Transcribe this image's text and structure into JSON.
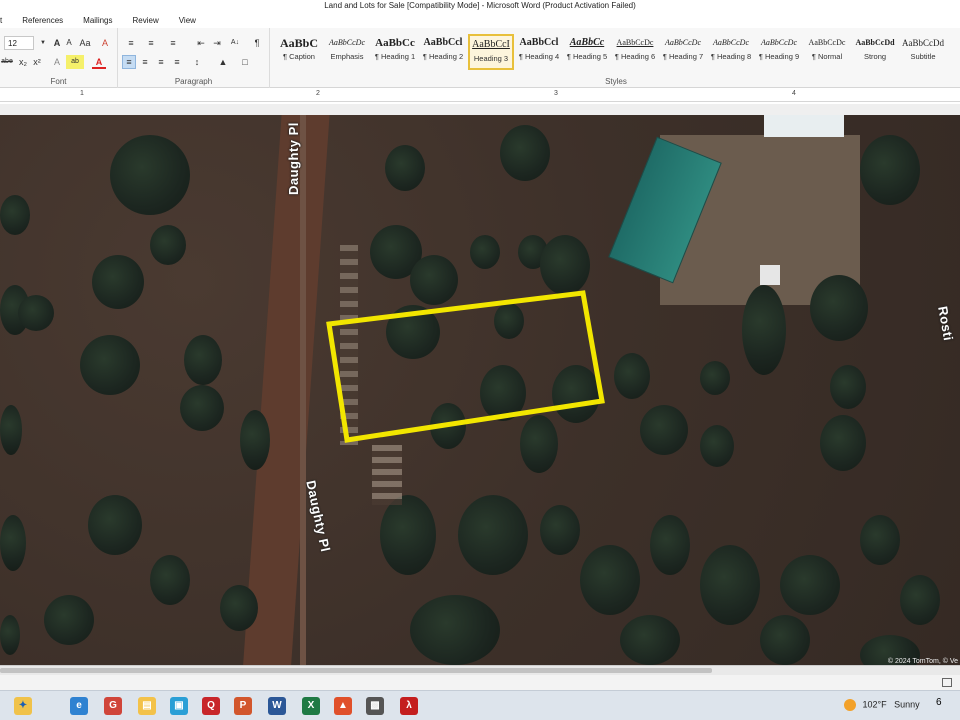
{
  "window": {
    "title": "Land and Lots for Sale [Compatibility Mode]  -  Microsoft Word (Product Activation Failed)",
    "tabs": [
      "t",
      "References",
      "Mailings",
      "Review",
      "View"
    ]
  },
  "ribbon": {
    "font": {
      "size": "12",
      "group_label": "Font",
      "grow_label": "A",
      "shrink_label": "A",
      "case_label": "Aa",
      "clear_label": "A",
      "strike_label": "abe",
      "sub_label": "x₂",
      "super_label": "x²",
      "highlight_label": "ab",
      "color_label": "A"
    },
    "paragraph": {
      "group_label": "Paragraph",
      "sort_label": "A↓",
      "pilcrow_label": "¶"
    },
    "styles": {
      "group_label": "Styles",
      "items": [
        {
          "sample": "AaBbC",
          "name": "¶ Caption"
        },
        {
          "sample": "AaBbCcDc",
          "name": "Emphasis"
        },
        {
          "sample": "AaBbCc",
          "name": "¶ Heading 1"
        },
        {
          "sample": "AaBbCcl",
          "name": "¶ Heading 2"
        },
        {
          "sample": "AaBbCcI",
          "name": "Heading 3"
        },
        {
          "sample": "AaBbCcl",
          "name": "¶ Heading 4"
        },
        {
          "sample": "AaBbCc",
          "name": "¶ Heading 5"
        },
        {
          "sample": "AaBbCcDc",
          "name": "¶ Heading 6"
        },
        {
          "sample": "AaBbCcDc",
          "name": "¶ Heading 7"
        },
        {
          "sample": "AaBbCcDc",
          "name": "¶ Heading 8"
        },
        {
          "sample": "AaBbCcDc",
          "name": "¶ Heading 9"
        },
        {
          "sample": "AaBbCcDc",
          "name": "¶ Normal"
        },
        {
          "sample": "AaBbCcDd",
          "name": "Strong"
        },
        {
          "sample": "AaBbCcDd",
          "name": "Subtitle"
        }
      ]
    }
  },
  "ruler": {
    "numbers": [
      "1",
      "2",
      "3",
      "4"
    ]
  },
  "map": {
    "road_label_top": "Daughty Pl",
    "road_label_bottom": "Daughty Pl",
    "road_label_right": "Rosti",
    "attribution": "© 2024 TomTom, © Ve",
    "boundary_color": "#f2e600"
  },
  "taskbar": {
    "weather": {
      "temp": "102°F",
      "condition": "Sunny"
    },
    "clock_fragment": "6"
  }
}
